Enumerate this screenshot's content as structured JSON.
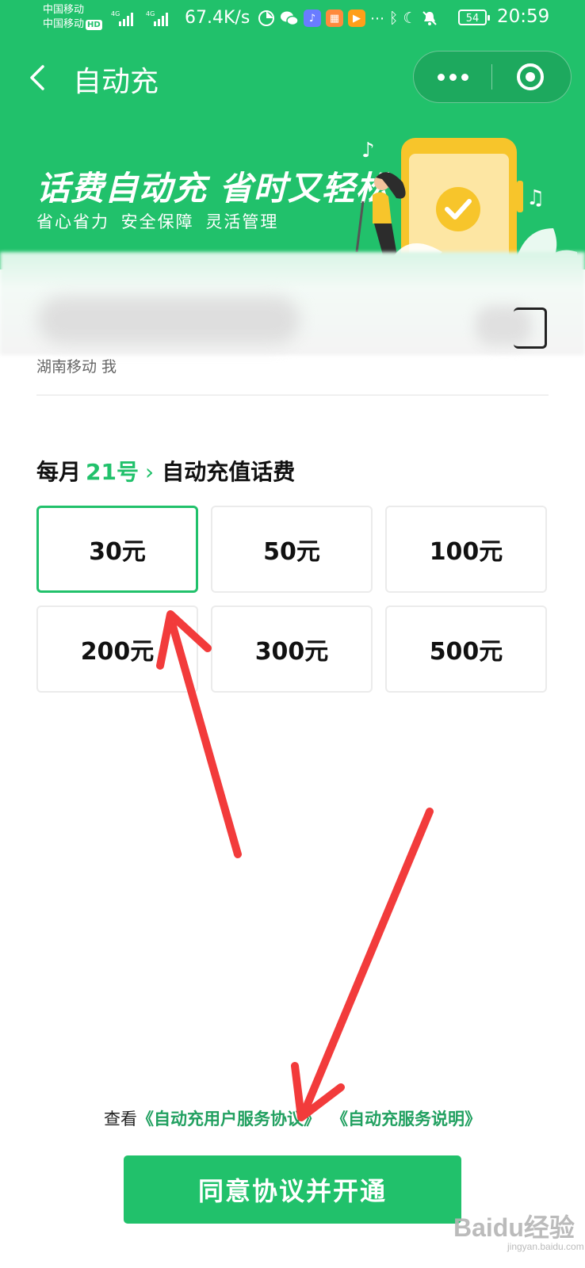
{
  "status_bar": {
    "carrier_1": "中国移动",
    "carrier_2": "中国移动",
    "carrier_2_badge": "HD",
    "network_speed": "67.4K/s",
    "battery": "54",
    "time": "20:59"
  },
  "nav": {
    "title": "自动充"
  },
  "banner": {
    "headline": "话费自动充 省时又轻松",
    "subline": "省心省力 安全保障 灵活管理"
  },
  "account": {
    "operator": "湖南移动 我"
  },
  "recharge": {
    "prefix": "每月",
    "day": "21号",
    "suffix": "自动充值话费",
    "selected": "30元",
    "amounts": [
      "30元",
      "50元",
      "100元",
      "200元",
      "300元",
      "500元"
    ]
  },
  "agreement": {
    "prefix": "查看",
    "link_1": "《自动充用户服务协议》",
    "link_2": "《自动充服务说明》"
  },
  "primary_button": {
    "label": "同意协议并开通"
  },
  "watermark": {
    "text": "Baidu经验",
    "sub": "jingyan.baidu.com"
  },
  "colors": {
    "brand_green": "#21c16b",
    "annotation_red": "#f23b3b"
  }
}
